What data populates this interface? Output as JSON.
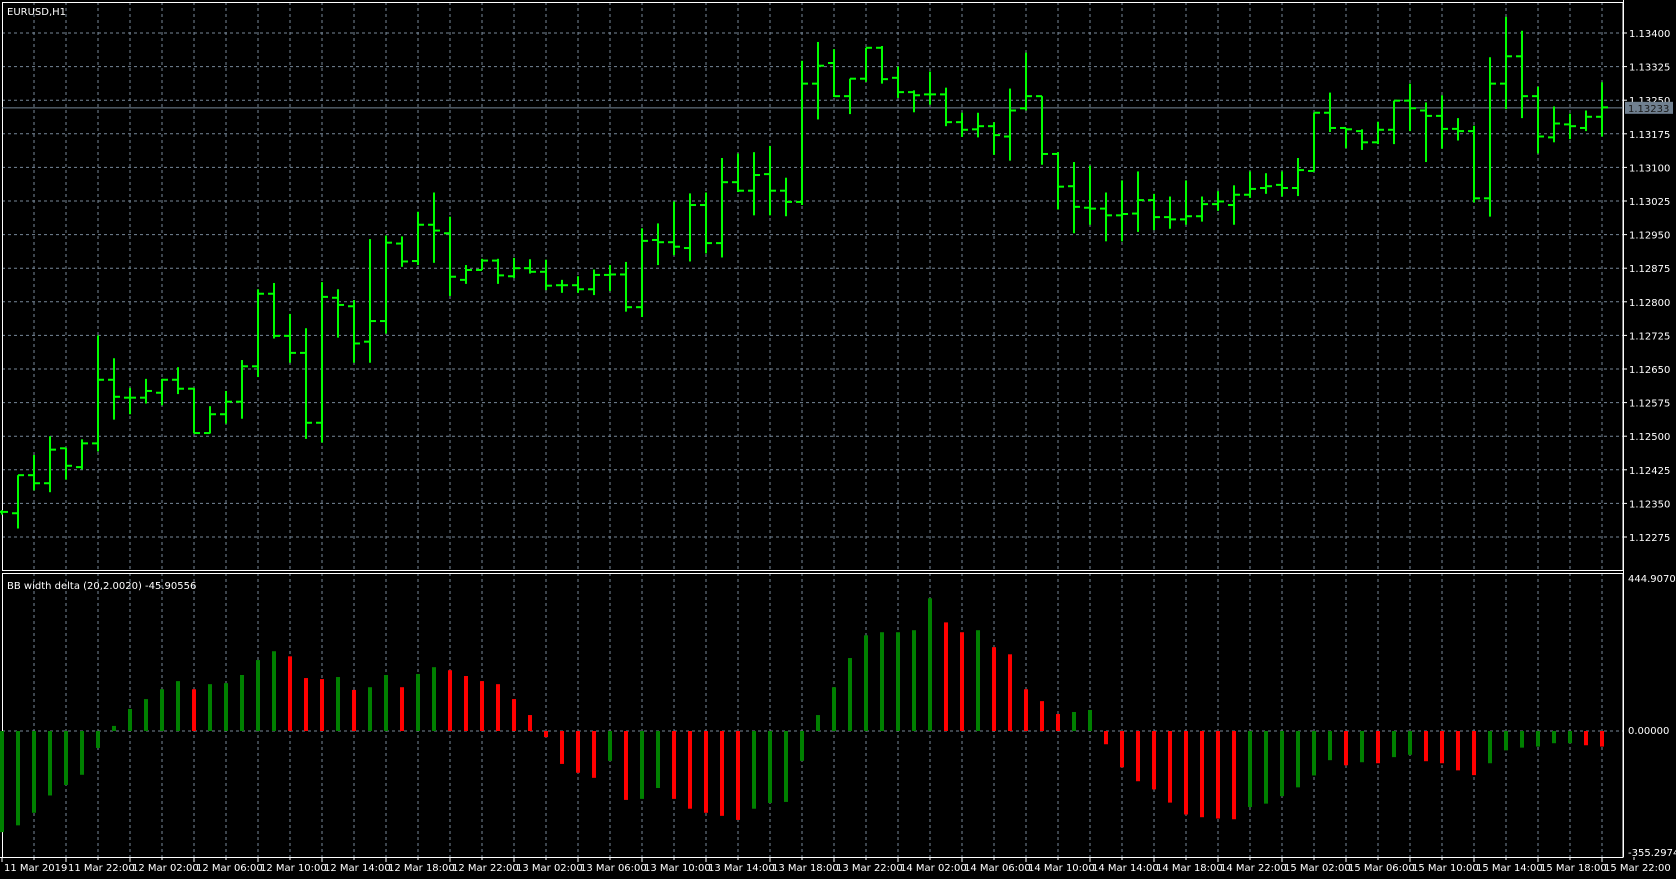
{
  "chart_data": {
    "type": "ohlc",
    "symbol_label": "EURUSD,H1",
    "current_price": "1.13233",
    "price_ticks": [
      "1.13400",
      "1.13325",
      "1.13250",
      "1.13175",
      "1.13100",
      "1.13025",
      "1.12950",
      "1.12875",
      "1.12800",
      "1.12725",
      "1.12650",
      "1.12575",
      "1.12500",
      "1.12425",
      "1.12350",
      "1.12275"
    ],
    "time_labels": [
      "11 Mar 2019",
      "11 Mar 22:00",
      "12 Mar 02:00",
      "12 Mar 06:00",
      "12 Mar 10:00",
      "12 Mar 14:00",
      "12 Mar 18:00",
      "12 Mar 22:00",
      "13 Mar 02:00",
      "13 Mar 06:00",
      "13 Mar 10:00",
      "13 Mar 14:00",
      "13 Mar 18:00",
      "13 Mar 22:00",
      "14 Mar 02:00",
      "14 Mar 06:00",
      "14 Mar 10:00",
      "14 Mar 14:00",
      "14 Mar 18:00",
      "14 Mar 22:00",
      "15 Mar 02:00",
      "15 Mar 06:00",
      "15 Mar 10:00",
      "15 Mar 14:00",
      "15 Mar 18:00",
      "15 Mar 22:00"
    ],
    "ohlc": [
      [
        1.12331,
        1.12335,
        1.12325,
        1.12331
      ],
      [
        1.12328,
        1.12413,
        1.12294,
        1.12413
      ],
      [
        1.12413,
        1.12458,
        1.12379,
        1.12395
      ],
      [
        1.12395,
        1.125,
        1.12375,
        1.1247
      ],
      [
        1.12473,
        1.12474,
        1.12403,
        1.12434
      ],
      [
        1.12431,
        1.12493,
        1.12426,
        1.12484
      ],
      [
        1.12484,
        1.12725,
        1.12466,
        1.12626
      ],
      [
        1.12626,
        1.12674,
        1.12537,
        1.12588
      ],
      [
        1.12586,
        1.12608,
        1.12549,
        1.12586
      ],
      [
        1.12586,
        1.12628,
        1.12573,
        1.12601
      ],
      [
        1.12597,
        1.12628,
        1.12569,
        1.12626
      ],
      [
        1.12626,
        1.12654,
        1.12594,
        1.12606
      ],
      [
        1.12606,
        1.12608,
        1.12506,
        1.12507
      ],
      [
        1.12507,
        1.12567,
        1.12506,
        1.12549
      ],
      [
        1.12549,
        1.12601,
        1.12528,
        1.12577
      ],
      [
        1.12577,
        1.1267,
        1.12539,
        1.12656
      ],
      [
        1.12656,
        1.12828,
        1.12632,
        1.12818
      ],
      [
        1.12818,
        1.12842,
        1.12718,
        1.12724
      ],
      [
        1.12724,
        1.12773,
        1.12664,
        1.12686
      ],
      [
        1.12686,
        1.12741,
        1.12494,
        1.1253
      ],
      [
        1.1253,
        1.12844,
        1.12486,
        1.12811
      ],
      [
        1.12809,
        1.12828,
        1.1272,
        1.12793
      ],
      [
        1.1279,
        1.12804,
        1.12664,
        1.12707
      ],
      [
        1.12711,
        1.1294,
        1.12664,
        1.12757
      ],
      [
        1.12757,
        1.12948,
        1.12729,
        1.12932
      ],
      [
        1.1293,
        1.12946,
        1.12878,
        1.1289
      ],
      [
        1.12891,
        1.13001,
        1.12882,
        1.12972
      ],
      [
        1.12972,
        1.13044,
        1.12887,
        1.12959
      ],
      [
        1.12953,
        1.1299,
        1.12813,
        1.12856
      ],
      [
        1.12849,
        1.12882,
        1.1284,
        1.12871
      ],
      [
        1.12871,
        1.12896,
        1.12871,
        1.12892
      ],
      [
        1.12892,
        1.12896,
        1.1284,
        1.12859
      ],
      [
        1.12857,
        1.12898,
        1.12853,
        1.12875
      ],
      [
        1.12875,
        1.12895,
        1.12863,
        1.12867
      ],
      [
        1.12867,
        1.12894,
        1.12826,
        1.12836
      ],
      [
        1.12837,
        1.12849,
        1.1282,
        1.12837
      ],
      [
        1.12837,
        1.12857,
        1.1282,
        1.12828
      ],
      [
        1.12828,
        1.12872,
        1.12815,
        1.1286
      ],
      [
        1.1286,
        1.12882,
        1.12824,
        1.12861
      ],
      [
        1.12861,
        1.12889,
        1.12778,
        1.12788
      ],
      [
        1.12788,
        1.12964,
        1.12766,
        1.12936
      ],
      [
        1.12938,
        1.12975,
        1.12882,
        1.12933
      ],
      [
        1.12933,
        1.13024,
        1.12904,
        1.12923
      ],
      [
        1.1292,
        1.13042,
        1.1289,
        1.13016
      ],
      [
        1.13016,
        1.13044,
        1.12908,
        1.12931
      ],
      [
        1.12931,
        1.13121,
        1.12899,
        1.13067
      ],
      [
        1.13067,
        1.13131,
        1.13045,
        1.13048
      ],
      [
        1.13048,
        1.13134,
        1.12993,
        1.13083
      ],
      [
        1.13085,
        1.13148,
        1.12993,
        1.13048
      ],
      [
        1.13048,
        1.13077,
        1.12991,
        1.13023
      ],
      [
        1.13023,
        1.13338,
        1.13016,
        1.13287
      ],
      [
        1.13287,
        1.1338,
        1.13207,
        1.13327
      ],
      [
        1.13333,
        1.13364,
        1.13257,
        1.13259
      ],
      [
        1.13259,
        1.13298,
        1.13219,
        1.13298
      ],
      [
        1.13298,
        1.13367,
        1.13291,
        1.13367
      ],
      [
        1.13367,
        1.13371,
        1.13287,
        1.13297
      ],
      [
        1.133,
        1.13325,
        1.13255,
        1.13268
      ],
      [
        1.13268,
        1.13272,
        1.13223,
        1.13261
      ],
      [
        1.13263,
        1.13314,
        1.1324,
        1.13263
      ],
      [
        1.13263,
        1.13278,
        1.13192,
        1.13201
      ],
      [
        1.13201,
        1.13222,
        1.13168,
        1.13184
      ],
      [
        1.13185,
        1.13222,
        1.13167,
        1.13192
      ],
      [
        1.13192,
        1.13201,
        1.13128,
        1.13172
      ],
      [
        1.13169,
        1.13276,
        1.13115,
        1.13227
      ],
      [
        1.13232,
        1.13356,
        1.13227,
        1.13259
      ],
      [
        1.13259,
        1.13259,
        1.13106,
        1.1313
      ],
      [
        1.1313,
        1.13134,
        1.13006,
        1.13057
      ],
      [
        1.13058,
        1.13112,
        1.12953,
        1.13012
      ],
      [
        1.1301,
        1.13104,
        1.12972,
        1.13008
      ],
      [
        1.13008,
        1.13044,
        1.12935,
        1.12993
      ],
      [
        1.12993,
        1.13071,
        1.12935,
        1.12996
      ],
      [
        1.12997,
        1.13091,
        1.12956,
        1.13027
      ],
      [
        1.13027,
        1.13041,
        1.1296,
        1.12989
      ],
      [
        1.12989,
        1.13035,
        1.12963,
        1.12984
      ],
      [
        1.12984,
        1.13071,
        1.12972,
        1.12991
      ],
      [
        1.12991,
        1.13035,
        1.12979,
        1.13018
      ],
      [
        1.13018,
        1.13047,
        1.13003,
        1.13024
      ],
      [
        1.13016,
        1.1306,
        1.12972,
        1.13039
      ],
      [
        1.13039,
        1.13091,
        1.13032,
        1.13052
      ],
      [
        1.13054,
        1.13087,
        1.13041,
        1.13058
      ],
      [
        1.13061,
        1.13091,
        1.13035,
        1.13054
      ],
      [
        1.13054,
        1.13121,
        1.13036,
        1.13094
      ],
      [
        1.13092,
        1.13222,
        1.13091,
        1.13222
      ],
      [
        1.13222,
        1.13267,
        1.13179,
        1.13188
      ],
      [
        1.13188,
        1.13188,
        1.13143,
        1.13185
      ],
      [
        1.13181,
        1.13185,
        1.13139,
        1.13156
      ],
      [
        1.13156,
        1.13202,
        1.13152,
        1.13184
      ],
      [
        1.13184,
        1.13249,
        1.13152,
        1.13249
      ],
      [
        1.13249,
        1.13287,
        1.13181,
        1.13232
      ],
      [
        1.13227,
        1.13245,
        1.13112,
        1.13215
      ],
      [
        1.13215,
        1.13261,
        1.13142,
        1.13186
      ],
      [
        1.13186,
        1.1321,
        1.1316,
        1.13181
      ],
      [
        1.13181,
        1.13193,
        1.13022,
        1.13031
      ],
      [
        1.13031,
        1.13346,
        1.1299,
        1.13287
      ],
      [
        1.13287,
        1.13436,
        1.1323,
        1.13348
      ],
      [
        1.13348,
        1.13405,
        1.1321,
        1.13259
      ],
      [
        1.13259,
        1.1328,
        1.13131,
        1.13169
      ],
      [
        1.13167,
        1.13236,
        1.13156,
        1.13198
      ],
      [
        1.13196,
        1.1322,
        1.13163,
        1.13192
      ],
      [
        1.13188,
        1.13227,
        1.13181,
        1.13213
      ],
      [
        1.13213,
        1.1329,
        1.13169,
        1.13234
      ]
    ],
    "price_range": [
      1.12275,
      1.134
    ],
    "indicator": {
      "label": "BB width delta (20,2.0020) -45.90556",
      "max_label": "444.90700",
      "zero_label": "0.00000",
      "min_label": "-355.29743",
      "range": [
        -355.29743,
        444.907
      ],
      "values": [
        -298,
        -278,
        -241,
        -190,
        -159,
        -129,
        -50,
        15,
        65,
        94,
        123,
        147,
        123,
        138,
        141,
        165,
        209,
        235,
        220,
        156,
        153,
        159,
        121,
        129,
        165,
        129,
        168,
        188,
        179,
        162,
        147,
        138,
        94,
        47,
        -18,
        -97,
        -123,
        -138,
        -88,
        -203,
        -200,
        -168,
        -200,
        -229,
        -241,
        -250,
        -262,
        -229,
        -212,
        -209,
        -88,
        47,
        129,
        215,
        282,
        291,
        291,
        297,
        391,
        320,
        291,
        297,
        247,
        226,
        123,
        88,
        50,
        56,
        62,
        -39,
        -107,
        -148,
        -172,
        -211,
        -246,
        -254,
        -258,
        -260,
        -224,
        -214,
        -192,
        -166,
        -131,
        -86,
        -101,
        -92,
        -95,
        -77,
        -70,
        -89,
        -95,
        -116,
        -130,
        -95,
        -57,
        -49,
        -46,
        -36,
        -36,
        -42,
        -45.90556
      ]
    },
    "colors": {
      "background": "#000000",
      "bars": "#00ff00",
      "grid": "#778899",
      "hist_up": "#008000",
      "hist_down": "#ff0000",
      "price_line": "#778899",
      "frame": "#ffffff"
    }
  }
}
